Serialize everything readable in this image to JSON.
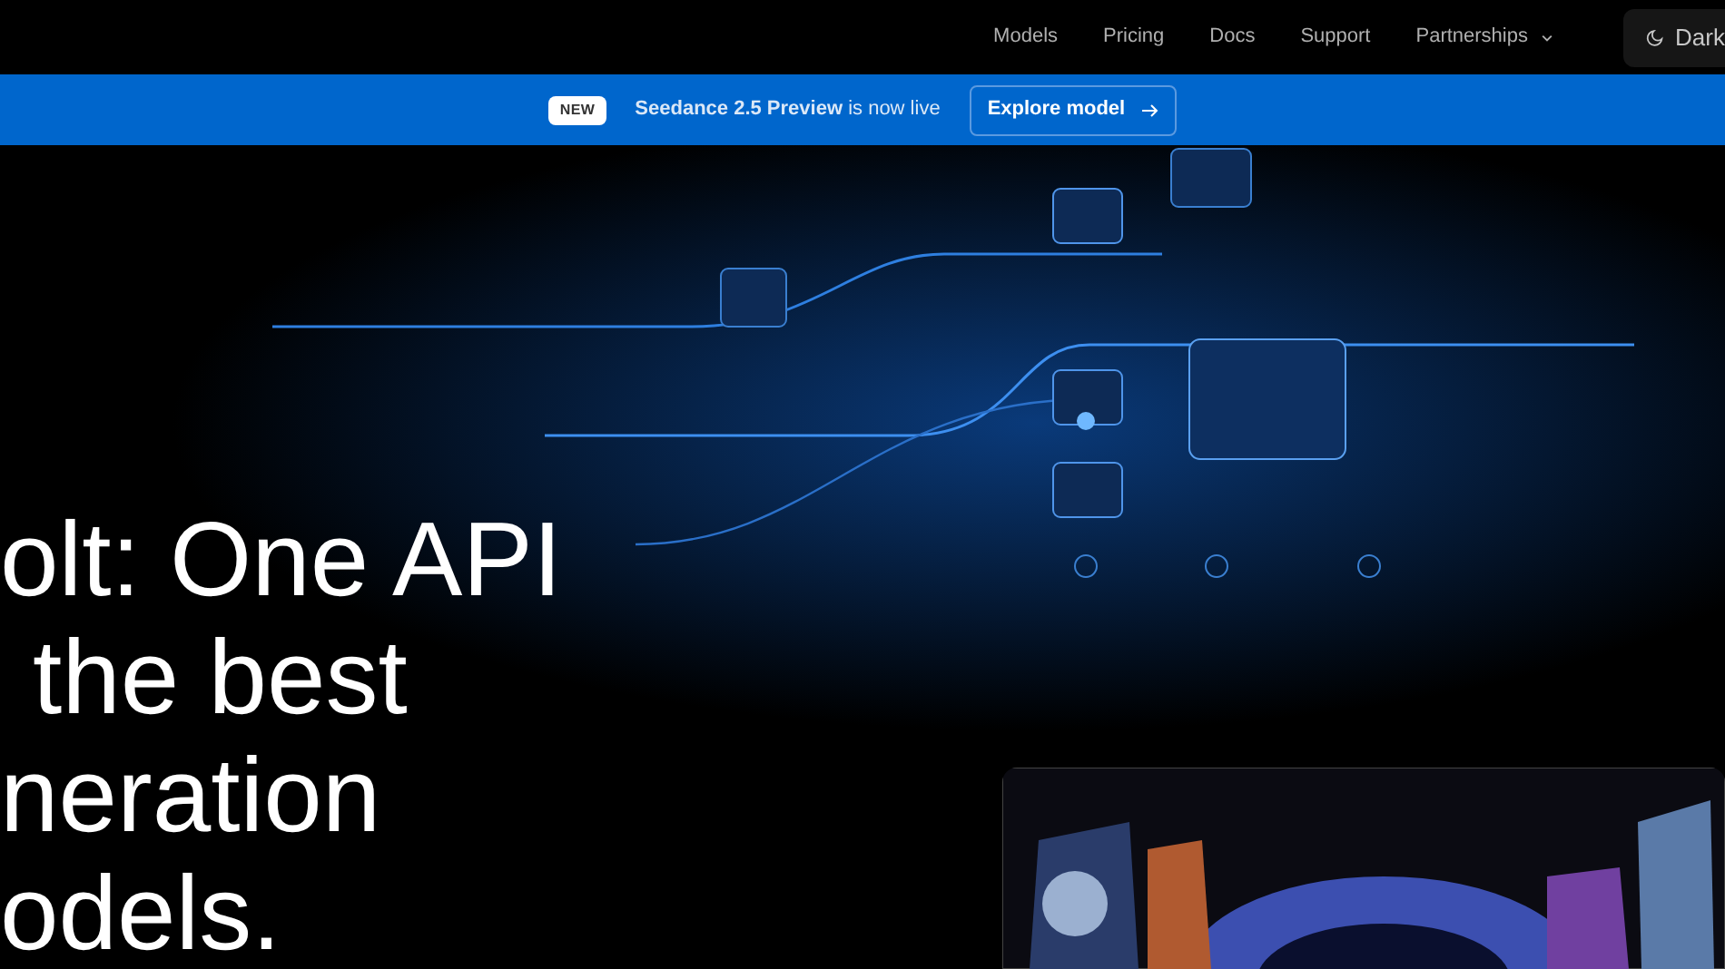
{
  "nav": {
    "links": [
      {
        "label": "Models",
        "dropdown": false
      },
      {
        "label": "Pricing",
        "dropdown": false
      },
      {
        "label": "Docs",
        "dropdown": false
      },
      {
        "label": "Support",
        "dropdown": false
      },
      {
        "label": "Partnerships",
        "dropdown": true
      }
    ],
    "theme_button": {
      "label": "Dark"
    }
  },
  "banner": {
    "badge": "NEW",
    "message": "**Seedance 2.5 Preview** is now live",
    "button": "Explore model"
  },
  "hero": {
    "headline_lines": [
      "olt: One API",
      "the best",
      "neration",
      "odels."
    ]
  }
}
